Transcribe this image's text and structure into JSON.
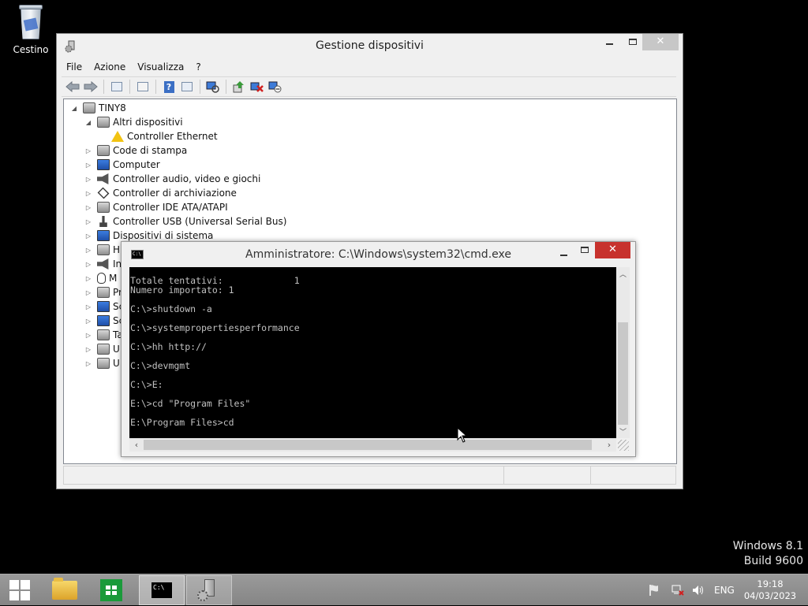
{
  "desktop": {
    "recycle_bin_label": "Cestino",
    "watermark": {
      "line1": "Windows 8.1",
      "line2": "Build 9600"
    }
  },
  "device_manager": {
    "title": "Gestione dispositivi",
    "menu": [
      "File",
      "Azione",
      "Visualizza",
      "?"
    ],
    "toolbar_icons": [
      "back-icon",
      "forward-icon",
      "console-tree-icon",
      "properties-icon",
      "help-icon",
      "action-pane-icon",
      "scan-hardware-icon",
      "update-driver-icon",
      "uninstall-icon",
      "disable-icon"
    ],
    "tree": {
      "root": "TINY8",
      "items": [
        {
          "label": "Altri dispositivi",
          "expanded": true,
          "icon": "unknown-device-icon"
        },
        {
          "label": "Controller Ethernet",
          "child": true,
          "icon": "warning-device-icon"
        },
        {
          "label": "Code di stampa",
          "icon": "printer-icon"
        },
        {
          "label": "Computer",
          "icon": "computer-icon"
        },
        {
          "label": "Controller audio, video e giochi",
          "icon": "speaker-icon"
        },
        {
          "label": "Controller di archiviazione",
          "icon": "storage-controller-icon"
        },
        {
          "label": "Controller IDE ATA/ATAPI",
          "icon": "ide-controller-icon"
        },
        {
          "label": "Controller USB (Universal Serial Bus)",
          "icon": "usb-icon"
        },
        {
          "label": "Dispositivi di sistema",
          "icon": "system-device-icon"
        },
        {
          "label": "H",
          "icon": "hid-icon"
        },
        {
          "label": "In",
          "icon": "input-icon"
        },
        {
          "label": "M",
          "icon": "mouse-icon"
        },
        {
          "label": "Pr",
          "icon": "processor-icon"
        },
        {
          "label": "Sc",
          "icon": "display-adapter-icon"
        },
        {
          "label": "Sc",
          "icon": "monitor-icon"
        },
        {
          "label": "Ta",
          "icon": "keyboard-icon"
        },
        {
          "label": "U",
          "icon": "disk-drive-icon"
        },
        {
          "label": "U",
          "icon": "volume-icon"
        }
      ]
    }
  },
  "cmd": {
    "title": "Amministratore: C:\\Windows\\system32\\cmd.exe",
    "icon_text": "C:\\",
    "lines": [
      "Totale tentativi:             1",
      "Numero importato: 1",
      "",
      "C:\\>shutdown -a",
      "",
      "C:\\>systempropertiesperformance",
      "",
      "C:\\>hh http://",
      "",
      "C:\\>devmgmt",
      "",
      "C:\\>E:",
      "",
      "E:\\>cd \"Program Files\"",
      "",
      "E:\\Program Files>cd"
    ]
  },
  "taskbar": {
    "apps": [
      "start-button",
      "file-explorer",
      "store",
      "command-prompt",
      "device-manager"
    ],
    "cmd_icon_text": "C:\\",
    "tray": {
      "language": "ENG",
      "time": "19:18",
      "date": "04/03/2023"
    }
  }
}
